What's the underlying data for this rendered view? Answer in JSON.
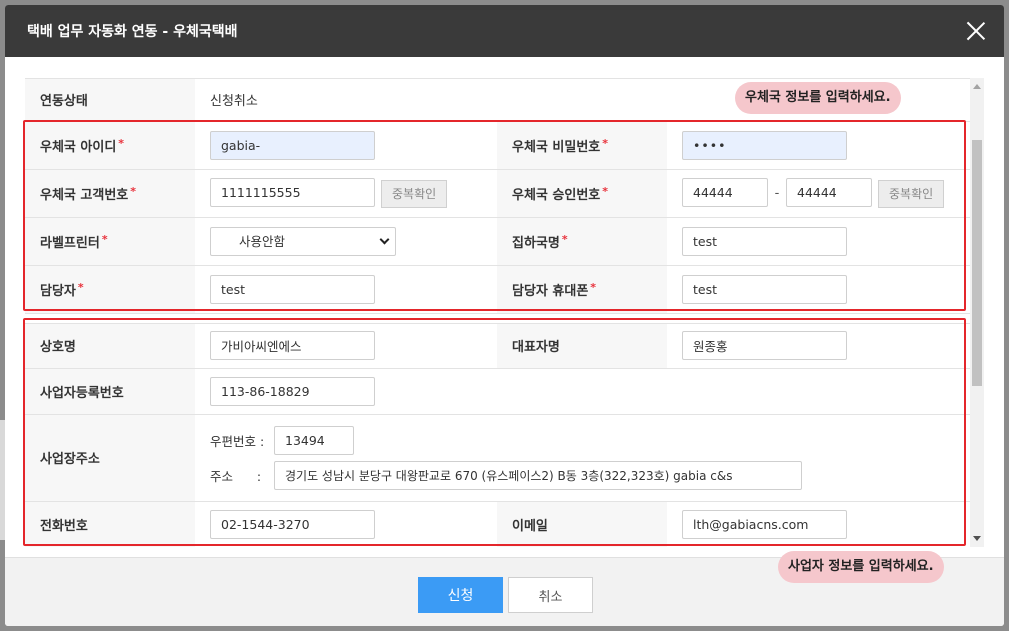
{
  "modal": {
    "title": "택배 업무 자동화 연동 - 우체국택배",
    "close_icon": "close-icon"
  },
  "status": {
    "label": "연동상태",
    "value": "신청취소"
  },
  "hints": {
    "postal": "우체국 정보를 입력하세요.",
    "business": "사업자 정보를 입력하세요."
  },
  "postal_info": {
    "id_label": "우체국 아이디",
    "id_value": "gabia-",
    "pw_label": "우체국 비밀번호",
    "pw_value": "••••",
    "customer_no_label": "우체국 고객번호",
    "customer_no_value": "1111115555",
    "dup_check_label": "중복확인",
    "approval_no_label": "우체국 승인번호",
    "approval_no_1": "44444",
    "approval_no_2": "44444",
    "approval_sep": "-",
    "printer_label": "라벨프린터",
    "printer_value": "사용안함",
    "office_label": "집하국명",
    "office_value": "test",
    "manager_label": "담당자",
    "manager_value": "test",
    "manager_phone_label": "담당자 휴대폰",
    "manager_phone_value": "test",
    "required_mark": "*"
  },
  "business_info": {
    "company_label": "상호명",
    "company_value": "가비아씨엔에스",
    "ceo_label": "대표자명",
    "ceo_value": "원종홍",
    "reg_no_label": "사업자등록번호",
    "reg_no_value": "113-86-18829",
    "address_label": "사업장주소",
    "zip_label": "우편번호 :",
    "zip_value": "13494",
    "addr_label": "주소      :",
    "addr_value": "경기도 성남시 분당구 대왕판교로 670 (유스페이스2) B동 3층(322,323호) gabia c&s",
    "phone_label": "전화번호",
    "phone_value": "02-1544-3270",
    "email_label": "이메일",
    "email_value": "lth@gabiacns.com"
  },
  "footer": {
    "apply_label": "신청",
    "cancel_label": "취소"
  },
  "colors": {
    "header_bg": "#3a3a3a",
    "accent_blue": "#3b9bf5",
    "highlight_red": "#e4262b",
    "bubble_pink": "#f5c7cc"
  }
}
